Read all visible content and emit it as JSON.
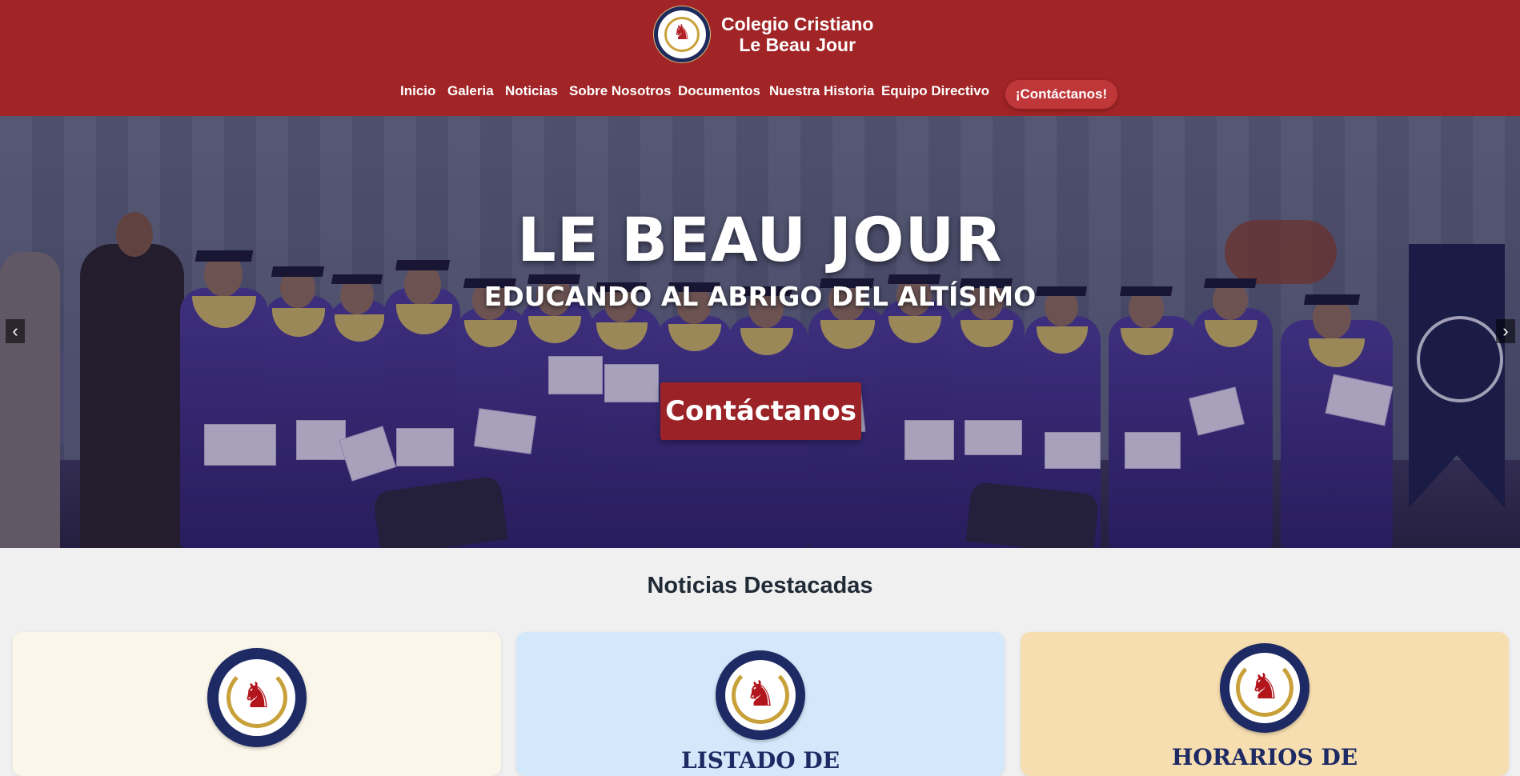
{
  "brand": {
    "line1": "Colegio Cristiano",
    "line2": "Le Beau Jour",
    "logo_icon": "school-crest-icon"
  },
  "nav": {
    "items": [
      "Inicio",
      "Galeria",
      "Noticias",
      "Sobre Nosotros",
      "Documentos",
      "Nuestra Historia",
      "Equipo Directivo"
    ],
    "cta": "¡Contáctanos!"
  },
  "hero": {
    "title": "LE BEAU JOUR",
    "subtitle": "EDUCANDO AL ABRIGO DEL ALTÍSIMO",
    "button": "Contáctanos",
    "prev_icon": "‹",
    "next_icon": "›"
  },
  "news": {
    "title": "Noticias Destacadas",
    "cards": [
      {
        "heading": "",
        "bg": "#fbf6ea"
      },
      {
        "heading": "LISTADO DE",
        "bg": "#d3e8fb"
      },
      {
        "heading": "HORARIOS DE",
        "bg": "#f6deb0"
      }
    ]
  },
  "colors": {
    "brand_red": "#a12426",
    "button_red": "#9b2226",
    "navy": "#1e2a63"
  }
}
